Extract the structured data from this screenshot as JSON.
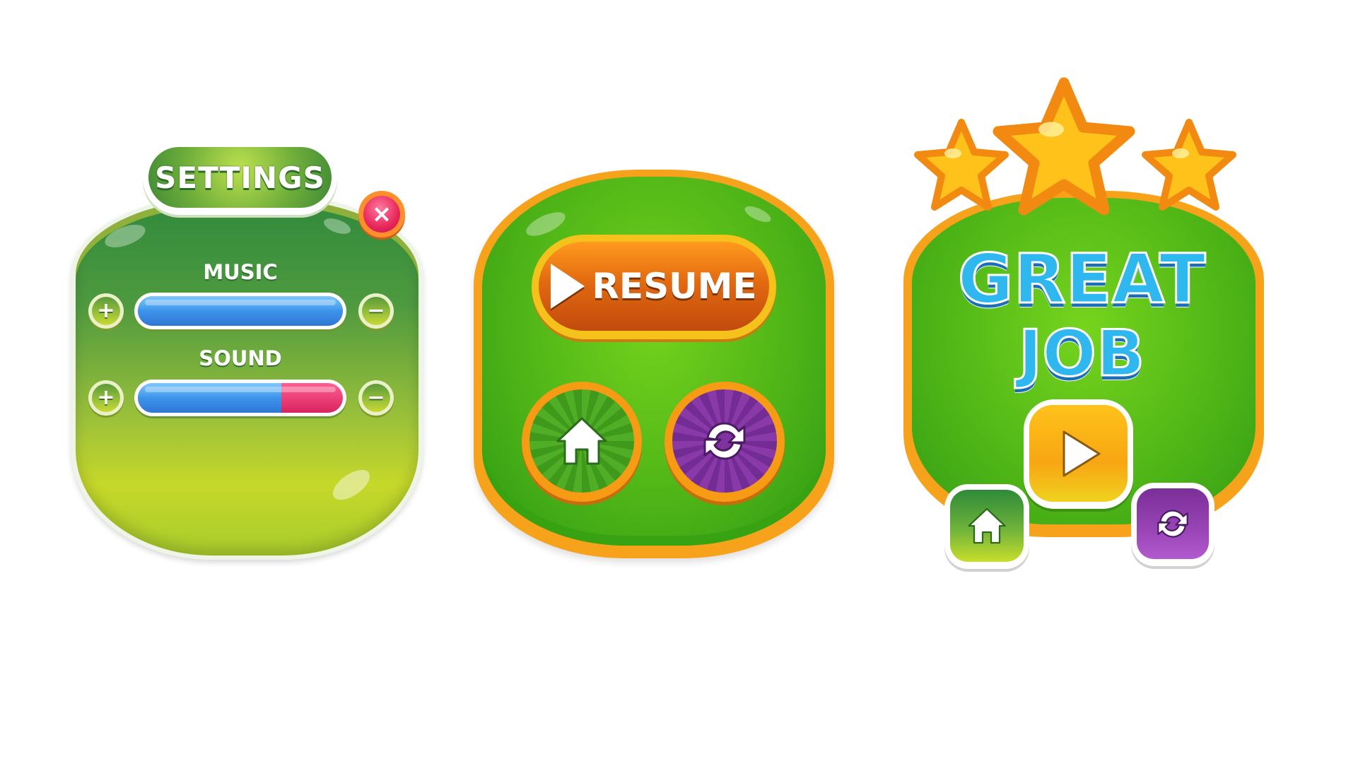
{
  "settings_panel": {
    "title": "SETTINGS",
    "close_label": "×",
    "music": {
      "label": "MUSIC",
      "plus_label": "+",
      "minus_label": "−",
      "level": 1.0
    },
    "sound": {
      "label": "SOUND",
      "plus_label": "+",
      "minus_label": "−",
      "level": 0.7
    }
  },
  "pause_panel": {
    "resume_label": "RESUME",
    "home_icon": "home-icon",
    "restart_icon": "restart-icon"
  },
  "win_panel": {
    "title_line1": "GREAT",
    "title_line2": "JOB",
    "stars_earned": 3,
    "stars_total": 3,
    "play_icon": "play-icon",
    "home_icon": "home-icon",
    "restart_icon": "restart-icon"
  },
  "colors": {
    "panel_green": "#4fb517",
    "panel_border_orange": "#f7a21b",
    "slider_blue": "#3d94ea",
    "slider_pink": "#d8245e",
    "close_pink": "#e8265a",
    "title_blue": "#2fb8f0",
    "star_yellow": "#ffc21a",
    "purple": "#8a3aa8"
  }
}
